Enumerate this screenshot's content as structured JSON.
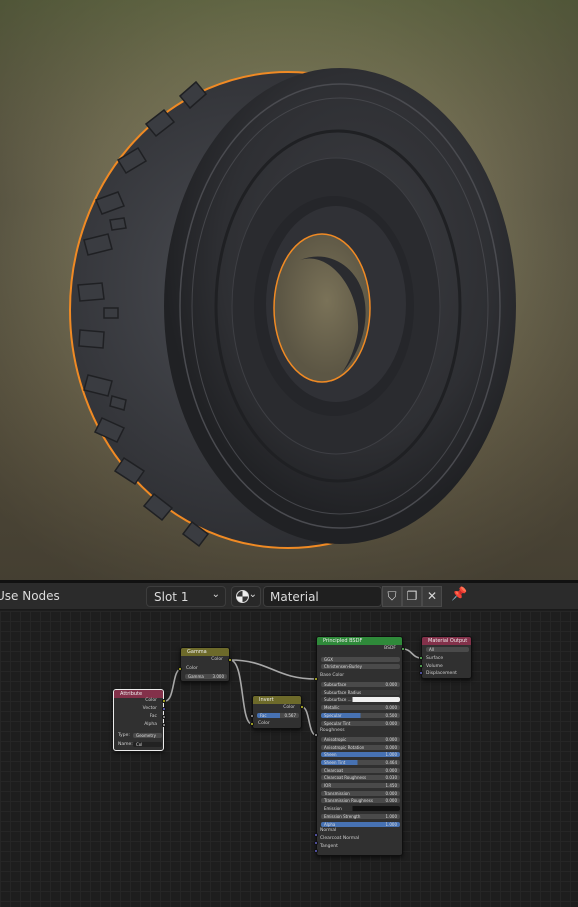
{
  "header": {
    "use_nodes": "Use Nodes",
    "slot": "Slot 1",
    "material_name": "Material",
    "close": "✕"
  },
  "nodes": {
    "attribute": {
      "title": "Attribute",
      "outputs": [
        "Color",
        "Vector",
        "Fac",
        "Alpha"
      ],
      "type_label": "Type:",
      "type_value": "Geometry",
      "name_label": "Name:",
      "name_value": "Col"
    },
    "gamma": {
      "title": "Gamma",
      "out": "Color",
      "in": "Color",
      "gamma_label": "Gamma",
      "gamma_value": "3.000"
    },
    "invert": {
      "title": "Invert",
      "out": "Color",
      "fac_label": "Fac",
      "fac_value": "0.567",
      "in": "Color"
    },
    "bsdf": {
      "title": "Principled BSDF",
      "out": "BSDF",
      "dist": "GGX",
      "sss_method": "Christensen-Burley",
      "base_color": "Base Color",
      "rows": [
        {
          "label": "Subsurface",
          "value": "0.000"
        },
        {
          "label": "Subsurface Radius",
          "value": ""
        },
        {
          "label": "Subsurface ...",
          "value": ""
        },
        {
          "label": "Metallic",
          "value": "0.000"
        },
        {
          "label": "Specular",
          "value": "0.500"
        },
        {
          "label": "Specular Tint",
          "value": "0.000"
        },
        {
          "label": "Roughness",
          "value": ""
        },
        {
          "label": "Anisotropic",
          "value": "0.000"
        },
        {
          "label": "Anisotropic Rotation",
          "value": "0.000"
        },
        {
          "label": "Sheen",
          "value": "1.000"
        },
        {
          "label": "Sheen Tint",
          "value": "0.464"
        },
        {
          "label": "Clearcoat",
          "value": "0.000"
        },
        {
          "label": "Clearcoat Roughness",
          "value": "0.030"
        },
        {
          "label": "IOR",
          "value": "1.450"
        },
        {
          "label": "Transmission",
          "value": "0.000"
        },
        {
          "label": "Transmission Roughness",
          "value": "0.000"
        },
        {
          "label": "Emission",
          "value": ""
        },
        {
          "label": "Emission Strength",
          "value": "1.000"
        },
        {
          "label": "Alpha",
          "value": "1.000"
        },
        {
          "label": "Normal",
          "value": ""
        },
        {
          "label": "Clearcoat Normal",
          "value": ""
        },
        {
          "label": "Tangent",
          "value": ""
        }
      ]
    },
    "output": {
      "title": "Material Output",
      "target": "All",
      "inputs": [
        "Surface",
        "Volume",
        "Displacement"
      ]
    }
  }
}
